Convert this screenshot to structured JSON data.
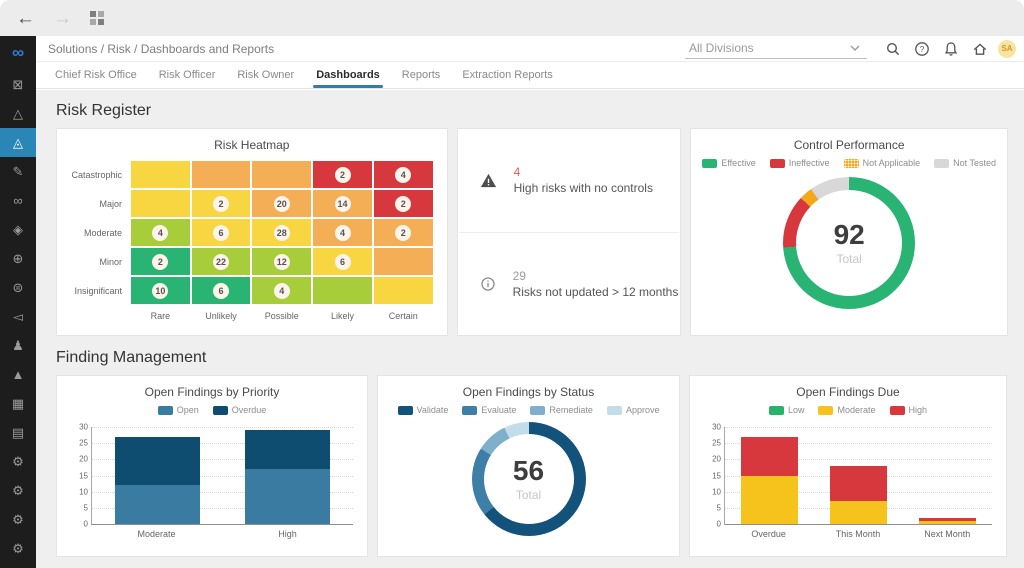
{
  "topbar": {
    "back_icon": "arrow-left",
    "forward_icon": "arrow-right",
    "apps_icon": "grid"
  },
  "sidebar": {
    "active_color": "#2b86b8",
    "items": [
      {
        "name": "logo",
        "glyph": "∞",
        "logo": true
      },
      {
        "name": "mail",
        "glyph": "⊠"
      },
      {
        "name": "triangle-outline",
        "glyph": "△"
      },
      {
        "name": "risk-register",
        "glyph": "◬",
        "active": true
      },
      {
        "name": "edit-pencil",
        "glyph": "✎"
      },
      {
        "name": "infinity",
        "glyph": "∞"
      },
      {
        "name": "diamond",
        "glyph": "◈"
      },
      {
        "name": "globe",
        "glyph": "⊕"
      },
      {
        "name": "globe-grid",
        "glyph": "⊜"
      },
      {
        "name": "megaphone",
        "glyph": "◅"
      },
      {
        "name": "person",
        "glyph": "♟"
      },
      {
        "name": "warning-filled",
        "glyph": "▲"
      },
      {
        "name": "building",
        "glyph": "▦"
      },
      {
        "name": "documents",
        "glyph": "▤"
      },
      {
        "name": "settings-1",
        "glyph": "⚙"
      },
      {
        "name": "settings-2",
        "glyph": "⚙"
      },
      {
        "name": "settings-3",
        "glyph": "⚙"
      },
      {
        "name": "settings-4",
        "glyph": "⚙"
      }
    ]
  },
  "header": {
    "breadcrumb": "Solutions / Risk / Dashboards and Reports",
    "division_selector": {
      "value": "All Divisions"
    },
    "icons": [
      "search",
      "help",
      "notifications",
      "home"
    ],
    "avatar": {
      "initials": "SA"
    }
  },
  "tabs": {
    "items": [
      {
        "label": "Chief Risk Office"
      },
      {
        "label": "Risk Officer"
      },
      {
        "label": "Risk Owner"
      },
      {
        "label": "Dashboards",
        "active": true
      },
      {
        "label": "Reports"
      },
      {
        "label": "Extraction Reports"
      }
    ]
  },
  "risk_register": {
    "title": "Risk Register",
    "stats": [
      {
        "icon": "warning-triangle",
        "value": "4",
        "value_color": "#e05c5c",
        "label": "High risks with no controls"
      },
      {
        "icon": "info-circle",
        "value": "29",
        "value_color": "#9a9a9a",
        "label": "Risks not updated > 12 months"
      }
    ]
  },
  "finding_management": {
    "title": "Finding Management"
  },
  "chart_data": [
    {
      "id": "risk_heatmap",
      "type": "heatmap",
      "title": "Risk Heatmap",
      "x_categories": [
        "Rare",
        "Unlikely",
        "Possible",
        "Likely",
        "Certain"
      ],
      "y_categories": [
        "Catastrophic",
        "Major",
        "Moderate",
        "Minor",
        "Insignificant"
      ],
      "palette": {
        "green": "#29b474",
        "yellowGreen": "#a8cd3a",
        "yellow": "#f7d642",
        "orange": "#f4ae55",
        "red": "#d6383e"
      },
      "cells": [
        [
          {
            "c": "yellow"
          },
          {
            "c": "orange"
          },
          {
            "c": "orange"
          },
          {
            "c": "red",
            "v": 2
          },
          {
            "c": "red",
            "v": 4
          }
        ],
        [
          {
            "c": "yellow"
          },
          {
            "c": "yellow",
            "v": 2
          },
          {
            "c": "orange",
            "v": 20
          },
          {
            "c": "orange",
            "v": 14
          },
          {
            "c": "red",
            "v": 2
          }
        ],
        [
          {
            "c": "yellowGreen",
            "v": 4
          },
          {
            "c": "yellow",
            "v": 6
          },
          {
            "c": "yellow",
            "v": 28
          },
          {
            "c": "orange",
            "v": 4
          },
          {
            "c": "orange",
            "v": 2
          }
        ],
        [
          {
            "c": "green",
            "v": 2
          },
          {
            "c": "yellowGreen",
            "v": 22
          },
          {
            "c": "yellowGreen",
            "v": 12
          },
          {
            "c": "yellow",
            "v": 6
          },
          {
            "c": "orange"
          }
        ],
        [
          {
            "c": "green",
            "v": 10
          },
          {
            "c": "green",
            "v": 6
          },
          {
            "c": "yellowGreen",
            "v": 4
          },
          {
            "c": "yellowGreen"
          },
          {
            "c": "yellow"
          }
        ]
      ]
    },
    {
      "id": "control_performance",
      "type": "donut",
      "title": "Control Performance",
      "center_value": "92",
      "center_label": "Total",
      "legend_position": "top",
      "series": [
        {
          "name": "Effective",
          "value": 68,
          "color": "#29b474"
        },
        {
          "name": "Ineffective",
          "value": 12,
          "color": "#d6383e"
        },
        {
          "name": "Not Applicable",
          "value": 3,
          "color": "#f5a81c",
          "pattern": "dots"
        },
        {
          "name": "Not Tested",
          "value": 9,
          "color": "#d8d8d8"
        }
      ]
    },
    {
      "id": "open_findings_by_priority",
      "type": "stacked_bar",
      "title": "Open Findings by Priority",
      "categories": [
        "Moderate",
        "High"
      ],
      "series": [
        {
          "name": "Open",
          "color": "#3a7ba2",
          "values": [
            12,
            17
          ]
        },
        {
          "name": "Overdue",
          "color": "#0e4d6f",
          "values": [
            15,
            12
          ]
        }
      ],
      "ylim": [
        0,
        30
      ],
      "yticks": [
        0,
        5,
        10,
        15,
        20,
        25,
        30
      ],
      "grid": true
    },
    {
      "id": "open_findings_by_status",
      "type": "donut",
      "title": "Open Findings by Status",
      "center_value": "56",
      "center_label": "Total",
      "legend_position": "top",
      "series": [
        {
          "name": "Validate",
          "value": 36,
          "color": "#13527a"
        },
        {
          "name": "Evaluate",
          "value": 11,
          "color": "#3d7fa7"
        },
        {
          "name": "Remediate",
          "value": 5,
          "color": "#7fb0cb"
        },
        {
          "name": "Approve",
          "value": 4,
          "color": "#c4dcea"
        }
      ]
    },
    {
      "id": "open_findings_due",
      "type": "stacked_bar",
      "title": "Open Findings Due",
      "categories": [
        "Overdue",
        "This Month",
        "Next Month"
      ],
      "series": [
        {
          "name": "Low",
          "color": "#27b36b",
          "values": [
            0,
            0,
            0
          ]
        },
        {
          "name": "Moderate",
          "color": "#f5c31c",
          "values": [
            15,
            7,
            1
          ]
        },
        {
          "name": "High",
          "color": "#d6383e",
          "values": [
            12,
            11,
            1
          ]
        }
      ],
      "ylim": [
        0,
        30
      ],
      "yticks": [
        0,
        5,
        10,
        15,
        20,
        25,
        30
      ],
      "grid": true
    }
  ]
}
